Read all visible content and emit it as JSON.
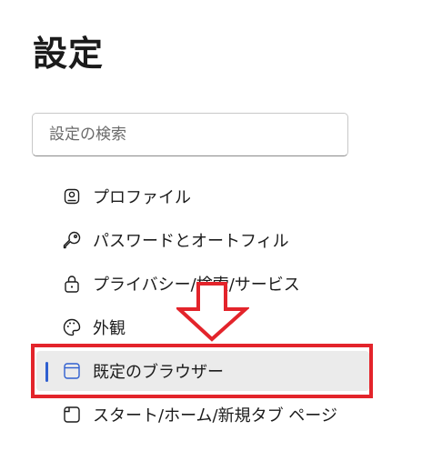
{
  "page": {
    "title": "設定"
  },
  "search": {
    "placeholder": "設定の検索",
    "value": ""
  },
  "nav": {
    "items": [
      {
        "label": "プロファイル",
        "icon": "profile-icon",
        "selected": false
      },
      {
        "label": "パスワードとオートフィル",
        "icon": "key-icon",
        "selected": false
      },
      {
        "label": "プライバシー/検索/サービス",
        "icon": "lock-icon",
        "selected": false
      },
      {
        "label": "外観",
        "icon": "palette-icon",
        "selected": false
      },
      {
        "label": "既定のブラウザー",
        "icon": "browser-window-icon",
        "selected": true
      },
      {
        "label": "スタート/ホーム/新規タブ ページ",
        "icon": "home-page-icon",
        "selected": false
      }
    ]
  },
  "colors": {
    "selection_indicator": "#2f5fd0",
    "selected_background": "#ebebeb",
    "annotation": "#e3242b"
  }
}
